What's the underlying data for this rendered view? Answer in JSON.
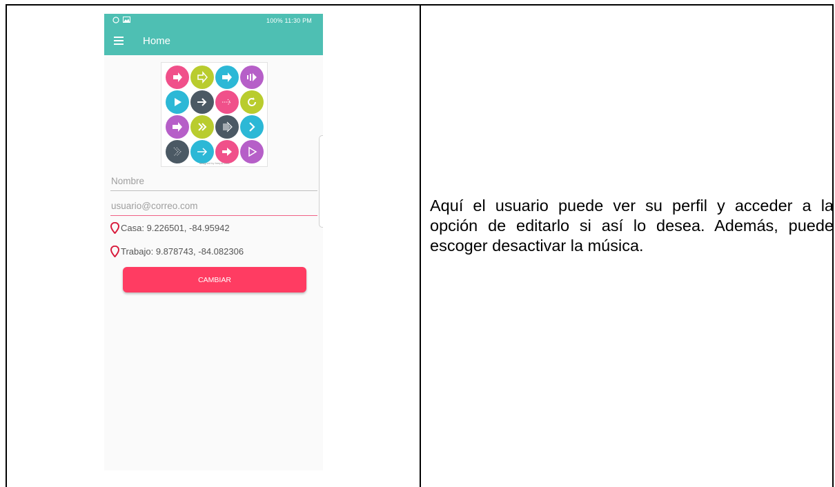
{
  "status_bar": {
    "right_text": "100%  11:30 PM"
  },
  "app_bar": {
    "title": "Home"
  },
  "logo": {
    "caption": "designed by freepik.com"
  },
  "form": {
    "name_placeholder": "Nombre",
    "email_placeholder": "usuario@correo.com"
  },
  "locations": {
    "home": "Casa: 9.226501, -84.95942",
    "work": "Trabajo: 9.878743, -84.082306"
  },
  "button": {
    "label": "CAMBIAR"
  },
  "description": "Aquí el usuario puede ver su perfil y acceder a la opción de editarlo si así lo desea. Además, puede escoger desactivar la música.",
  "colors": {
    "teal_app_bar": "#4ebfb3",
    "button_pink": "#ff3c62",
    "pin_red": "#d81b3c"
  }
}
